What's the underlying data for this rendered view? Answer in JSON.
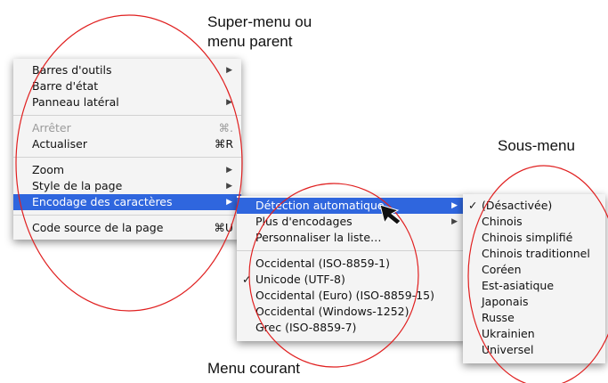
{
  "annotations": {
    "super_menu_line1": "Super-menu ou",
    "super_menu_line2": "menu parent",
    "sous_menu": "Sous-menu",
    "menu_courant": "Menu courant"
  },
  "parent_menu": {
    "items": [
      {
        "label": "Barres d'outils",
        "submenu": true
      },
      {
        "label": "Barre d'état"
      },
      {
        "label": "Panneau latéral",
        "submenu": true
      },
      {
        "label": "Arrêter",
        "shortcut": "⌘.",
        "disabled": true
      },
      {
        "label": "Actualiser",
        "shortcut": "⌘R"
      },
      {
        "label": "Zoom",
        "submenu": true
      },
      {
        "label": "Style de la page",
        "submenu": true
      },
      {
        "label": "Encodage des caractères",
        "submenu": true,
        "selected": true
      },
      {
        "label": "Code source de la page",
        "shortcut": "⌘U"
      }
    ]
  },
  "current_menu": {
    "items": [
      {
        "label": "Détection automatique",
        "submenu": true,
        "selected": true
      },
      {
        "label": "Plus d'encodages",
        "submenu": true
      },
      {
        "label": "Personnaliser la liste…"
      },
      {
        "label": "Occidental (ISO-8859-1)"
      },
      {
        "label": "Unicode (UTF-8)",
        "checked": true
      },
      {
        "label": "Occidental (Euro) (ISO-8859-15)"
      },
      {
        "label": "Occidental (Windows-1252)"
      },
      {
        "label": "Grec (ISO-8859-7)"
      }
    ]
  },
  "sub_menu": {
    "items": [
      {
        "label": "(Désactivée)",
        "checked": true
      },
      {
        "label": "Chinois"
      },
      {
        "label": "Chinois simplifié"
      },
      {
        "label": "Chinois traditionnel"
      },
      {
        "label": "Coréen"
      },
      {
        "label": "Est-asiatique"
      },
      {
        "label": "Japonais"
      },
      {
        "label": "Russe"
      },
      {
        "label": "Ukrainien"
      },
      {
        "label": "Universel"
      }
    ]
  },
  "glyphs": {
    "submenu_arrow": "▶",
    "checkmark": "✓"
  },
  "colors": {
    "selection": "#2f66de",
    "annotation_ellipse": "#e02020"
  }
}
